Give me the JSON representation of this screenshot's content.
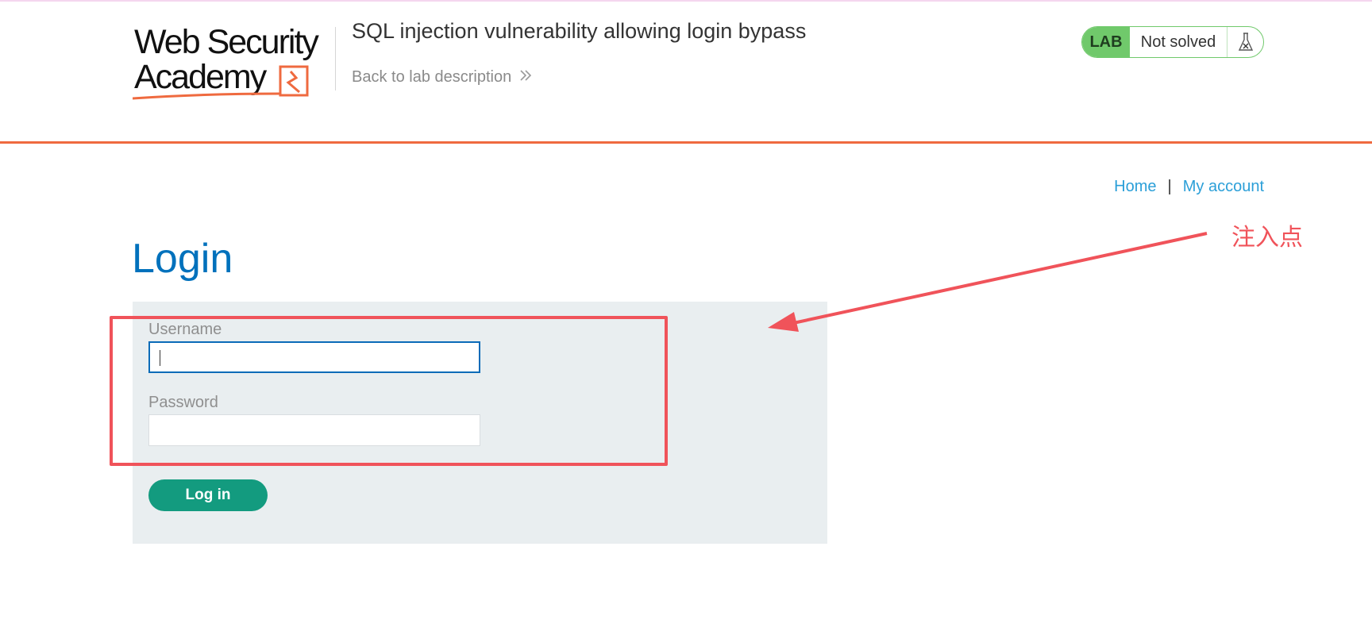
{
  "header": {
    "logo": {
      "line1": "Web Security",
      "line2": "Academy"
    },
    "lab_title": "SQL injection vulnerability allowing login bypass",
    "back_link": "Back to lab description",
    "status": {
      "badge": "LAB",
      "text": "Not solved",
      "icon": "flask-icon"
    }
  },
  "nav": {
    "home": "Home",
    "separator": "|",
    "my_account": "My account"
  },
  "page": {
    "title": "Login"
  },
  "form": {
    "username_label": "Username",
    "username_value": "",
    "password_label": "Password",
    "password_value": "",
    "submit_label": "Log in"
  },
  "annotation": {
    "label": "注入点",
    "color": "#f0535a"
  },
  "colors": {
    "accent_orange": "#ef6a3f",
    "title_blue": "#0071bc",
    "link_blue": "#2b9fd8",
    "lab_green": "#70c96b",
    "button_green": "#139b7f",
    "panel_bg": "#e9eef0"
  }
}
